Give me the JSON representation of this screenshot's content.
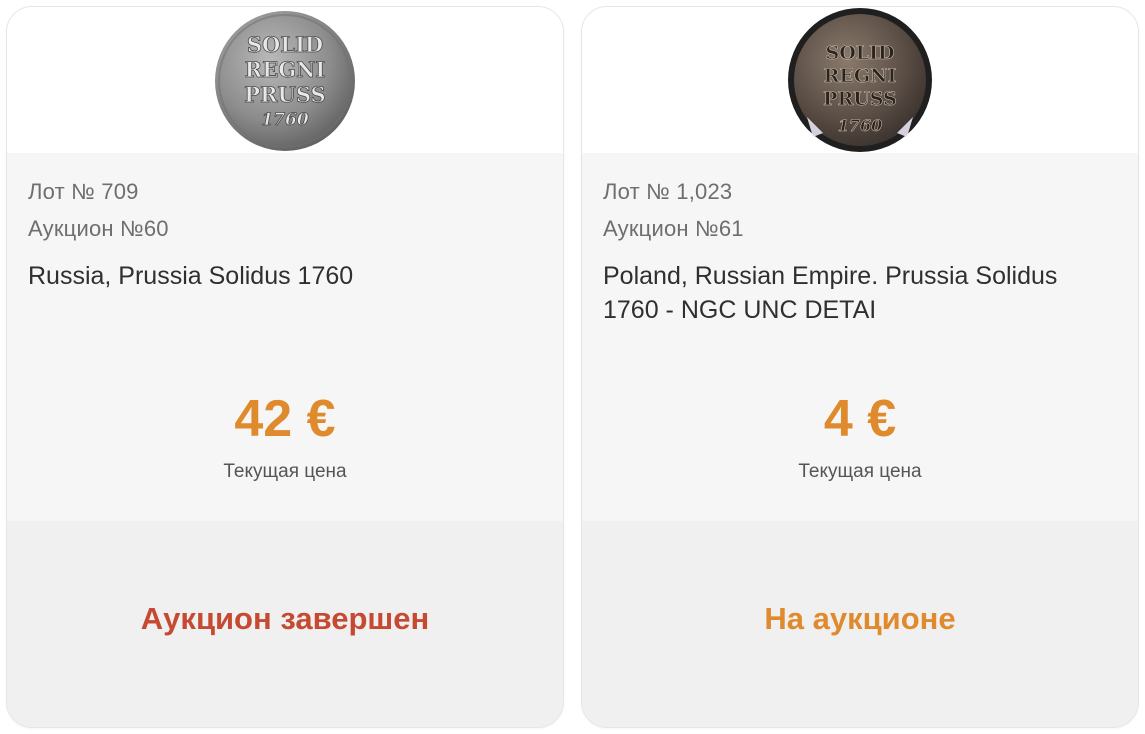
{
  "lots": [
    {
      "lot_label": "Лот № 709",
      "auction_label": "Аукцион №60",
      "title": "Russia, Prussia Solidus 1760",
      "price": "42 €",
      "price_caption": "Текущая цена",
      "status": "Аукцион завершен",
      "status_color": "#c64a32",
      "coin": {
        "line1": "SOLID",
        "line2": "REGNI",
        "line3": "PRUSS",
        "line4": "1760"
      }
    },
    {
      "lot_label": "Лот № 1,023",
      "auction_label": "Аукцион №61",
      "title": "Poland, Russian Empire. Prussia Solidus 1760 - NGC UNC DETAI",
      "price": "4 €",
      "price_caption": "Текущая цена",
      "status": "На аукционе",
      "status_color": "#e08a2e",
      "coin": {
        "line1": "SOLID",
        "line2": "REGNI",
        "line3": "PRUSS",
        "line4": "1760"
      }
    }
  ],
  "colors": {
    "accent_orange": "#e08a2e",
    "ended_red": "#c64a32"
  }
}
